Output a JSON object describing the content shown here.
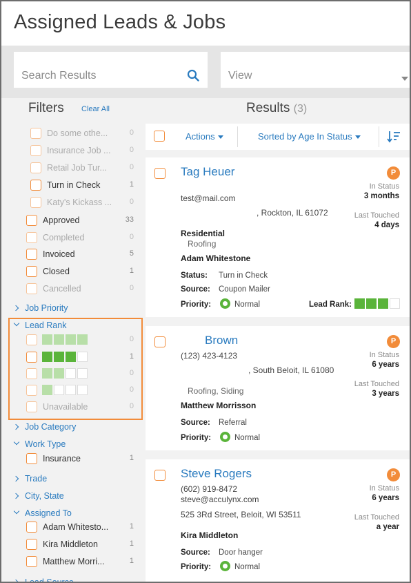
{
  "page": {
    "title": "Assigned Leads & Jobs"
  },
  "search": {
    "placeholder": "Search Results",
    "icon": "search-icon"
  },
  "view": {
    "placeholder": "View"
  },
  "filters": {
    "title": "Filters",
    "clear_all": "Clear All",
    "status_items": [
      {
        "label": "Do some othe...",
        "count": "0"
      },
      {
        "label": "Insurance Job ...",
        "count": "0"
      },
      {
        "label": "Retail Job Tur...",
        "count": "0"
      },
      {
        "label": "Turn in Check",
        "count": "1"
      },
      {
        "label": "Katy's Kickass ...",
        "count": "0"
      },
      {
        "label": "Approved",
        "count": "33"
      },
      {
        "label": "Completed",
        "count": "0"
      },
      {
        "label": "Invoiced",
        "count": "5"
      },
      {
        "label": "Closed",
        "count": "1"
      },
      {
        "label": "Cancelled",
        "count": "0"
      }
    ],
    "job_priority": "Job Priority",
    "lead_rank": {
      "label": "Lead Rank",
      "items": [
        {
          "level": 4,
          "count": "0"
        },
        {
          "level": 3,
          "count": "1"
        },
        {
          "level": 2,
          "count": "0"
        },
        {
          "level": 1,
          "count": "0"
        },
        {
          "label": "Unavailable",
          "count": "0"
        }
      ]
    },
    "job_category": "Job Category",
    "work_type": {
      "label": "Work Type",
      "items": [
        {
          "label": "Insurance",
          "count": "1"
        }
      ]
    },
    "trade": "Trade",
    "city_state": "City, State",
    "assigned_to": {
      "label": "Assigned To",
      "items": [
        {
          "label": "Adam Whitesto...",
          "count": "1"
        },
        {
          "label": "Kira Middleton",
          "count": "1"
        },
        {
          "label": "Matthew Morri...",
          "count": "1"
        }
      ]
    },
    "lead_source": "Lead Source"
  },
  "results": {
    "title": "Results",
    "count": "(3)",
    "actions": "Actions",
    "sorted": "Sorted by Age In Status",
    "cards": [
      {
        "name": "Tag Heuer",
        "badge": "P",
        "email": "test@mail.com",
        "address": ", Rockton, IL 61072",
        "type": "Residential",
        "trade": "Roofing",
        "assignee": "Adam Whitestone",
        "status_label": "Status:",
        "status": "Turn in Check",
        "source_label": "Source:",
        "source": "Coupon Mailer",
        "priority_label": "Priority:",
        "priority": "Normal",
        "in_status_label": "In Status",
        "in_status": "3 months",
        "last_touched_label": "Last Touched",
        "last_touched": "4 days",
        "lead_rank_label": "Lead Rank:",
        "lead_rank": 3
      },
      {
        "name": "Brown",
        "badge": "P",
        "phone": "(123) 423-4123",
        "address": ", South Beloit, IL 61080",
        "trade": "Roofing, Siding",
        "assignee": "Matthew Morrisson",
        "source_label": "Source:",
        "source": "Referral",
        "priority_label": "Priority:",
        "priority": "Normal",
        "in_status_label": "In Status",
        "in_status": "6 years",
        "last_touched_label": "Last Touched",
        "last_touched": "3 years"
      },
      {
        "name": "Steve Rogers",
        "badge": "P",
        "phone": "(602) 919-8472",
        "email": "steve@acculynx.com",
        "address": "525 3Rd Street, Beloit, WI 53511",
        "assignee": "Kira Middleton",
        "source_label": "Source:",
        "source": "Door hanger",
        "priority_label": "Priority:",
        "priority": "Normal",
        "in_status_label": "In Status",
        "in_status": "6 years",
        "last_touched_label": "Last Touched",
        "last_touched": "a year"
      }
    ]
  },
  "colors": {
    "accent": "#2a7bbf",
    "orange": "#f28c3a",
    "green": "#5ab43a",
    "light_green": "#b8dfa8",
    "panel": "#f2f2f2"
  }
}
